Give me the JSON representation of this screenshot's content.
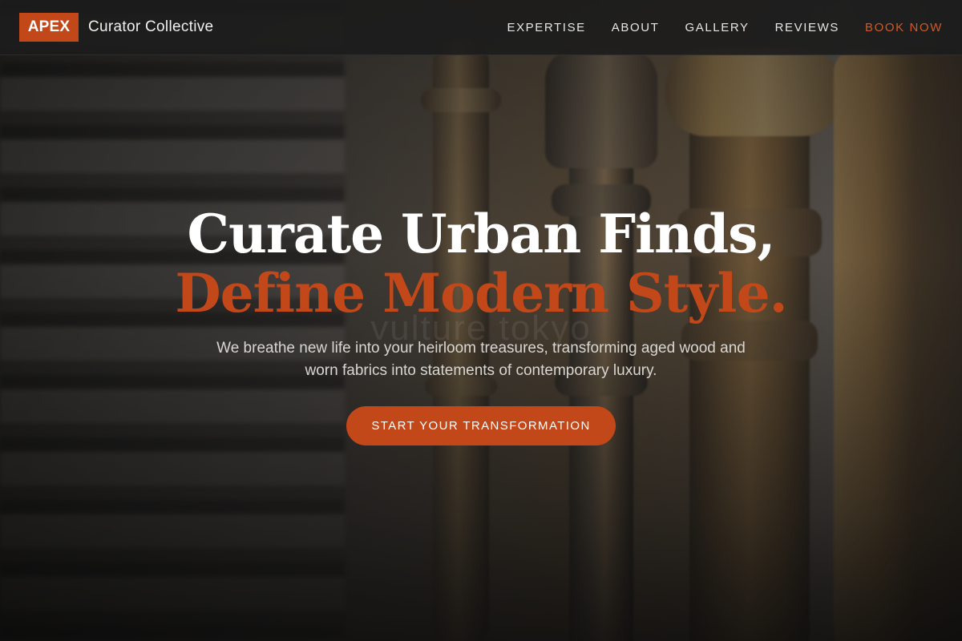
{
  "header": {
    "logo": "APEX",
    "brand_name": "Curator Collective",
    "nav": [
      {
        "label": "EXPERTISE"
      },
      {
        "label": "ABOUT"
      },
      {
        "label": "GALLERY"
      },
      {
        "label": "REVIEWS"
      },
      {
        "label": "BOOK NOW"
      }
    ]
  },
  "hero": {
    "headline_line1": "Curate Urban Finds,",
    "headline_line2": "Define Modern Style.",
    "watermark": "vulture tokyo",
    "subtitle": "We breathe new life into your heirloom treasures, transforming aged wood and worn fabrics into statements of contemporary luxury.",
    "cta_label": "START YOUR TRANSFORMATION"
  },
  "colors": {
    "accent": "#c2481a",
    "header_bg": "#1c1c1c",
    "text_primary": "#ffffff",
    "text_secondary": "#d9d6d2"
  }
}
